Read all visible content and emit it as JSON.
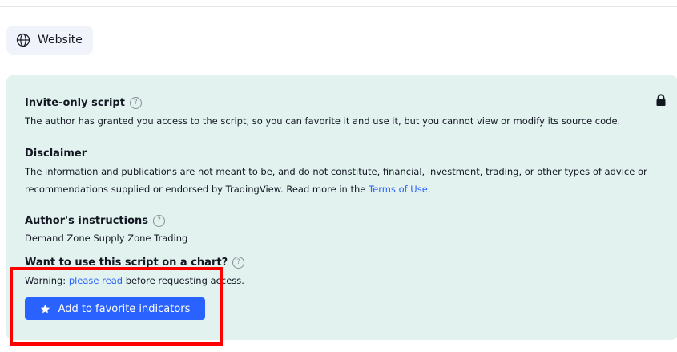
{
  "website_button": {
    "label": "Website",
    "icon": "globe-icon"
  },
  "panel": {
    "bg_color": "#e1f2ef",
    "lock_icon": "lock-icon",
    "invite": {
      "title": "Invite-only script",
      "help": "?",
      "text": "The author has granted you access to the script, so you can favorite it and use it, but you cannot view or modify its source code."
    },
    "disclaimer": {
      "title": "Disclaimer",
      "line1": "The information and publications are not meant to be, and do not constitute, financial, investment, trading, or other types of advice or",
      "line2_prefix": "recommendations supplied or endorsed by TradingView. Read more in the ",
      "link": "Terms of Use",
      "line2_suffix": "."
    },
    "instructions": {
      "title": "Author's instructions",
      "help": "?",
      "text": "Demand Zone Supply Zone Trading"
    },
    "use_script": {
      "title": "Want to use this script on a chart?",
      "help": "?",
      "warning_prefix": "Warning: ",
      "warning_link": "please read",
      "warning_suffix": " before requesting access."
    },
    "favorite_button": {
      "label": "Add to favorite indicators",
      "icon": "star-icon",
      "color": "#2962ff"
    }
  },
  "highlight_color": "#ff0000"
}
